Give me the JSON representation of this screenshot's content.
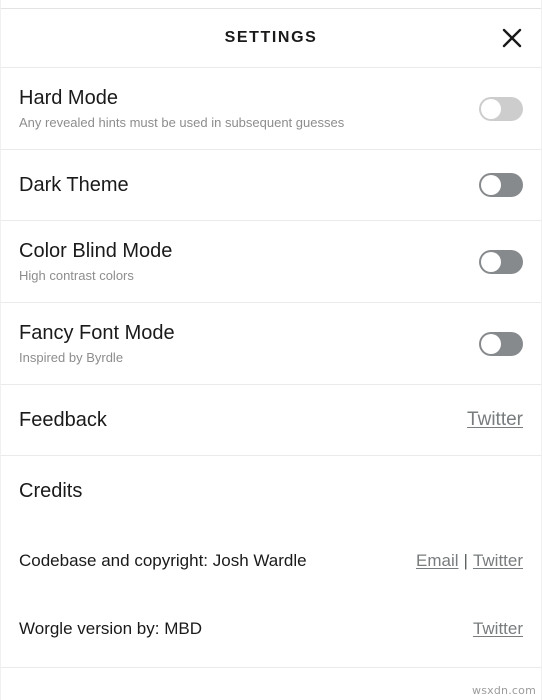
{
  "header": {
    "title": "SETTINGS",
    "close_icon": "close-icon"
  },
  "settings": [
    {
      "id": "hard-mode",
      "title": "Hard Mode",
      "description": "Any revealed hints must be used in subsequent guesses",
      "control": "toggle",
      "state": "off",
      "disabled": true
    },
    {
      "id": "dark-theme",
      "title": "Dark Theme",
      "description": "",
      "control": "toggle",
      "state": "off",
      "disabled": false
    },
    {
      "id": "color-blind-mode",
      "title": "Color Blind Mode",
      "description": "High contrast colors",
      "control": "toggle",
      "state": "off",
      "disabled": false
    },
    {
      "id": "fancy-font-mode",
      "title": "Fancy Font Mode",
      "description": "Inspired by Byrdle",
      "control": "toggle",
      "state": "off",
      "disabled": false
    }
  ],
  "feedback": {
    "title": "Feedback",
    "link_label": "Twitter"
  },
  "credits": {
    "heading": "Credits",
    "rows": [
      {
        "label": "Codebase and copyright: Josh Wardle",
        "links": [
          "Email",
          "Twitter"
        ],
        "separator": "|"
      },
      {
        "label": "Worgle version by: MBD",
        "links": [
          "Twitter"
        ],
        "separator": ""
      }
    ]
  },
  "watermark": "wsxdn.com",
  "colors": {
    "text": "#1a1a1b",
    "muted": "#8d8d8d",
    "link": "#787c7e",
    "toggle_on_track": "#878a8c",
    "toggle_disabled_track": "#cdcdcd",
    "divider": "#eaeaea"
  }
}
